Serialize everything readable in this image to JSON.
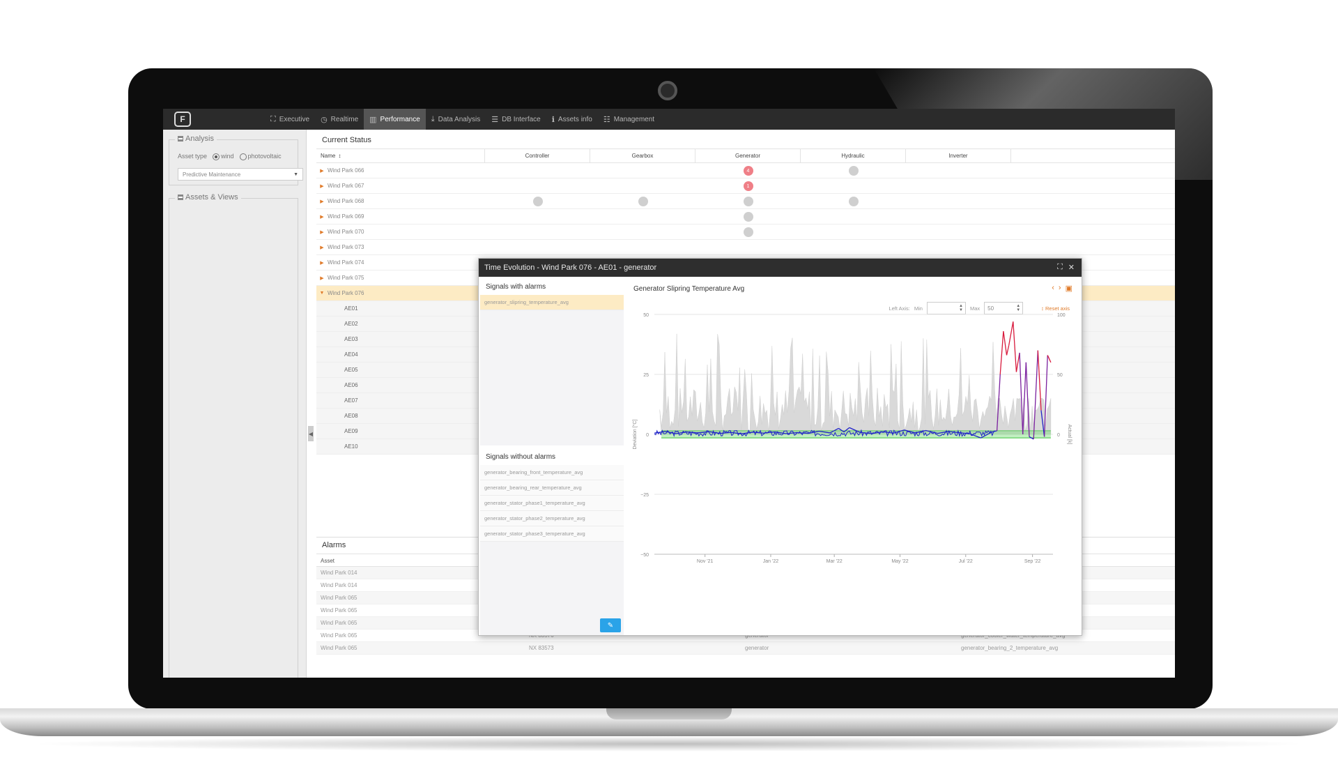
{
  "nav": {
    "logo": "F",
    "items": [
      {
        "label": "Executive",
        "icon": "chart-line-icon",
        "glyph": "⛶"
      },
      {
        "label": "Realtime",
        "icon": "clock-icon",
        "glyph": "◷"
      },
      {
        "label": "Performance",
        "icon": "bar-chart-icon",
        "glyph": "▥"
      },
      {
        "label": "Data Analysis",
        "icon": "download-icon",
        "glyph": "⤓"
      },
      {
        "label": "DB Interface",
        "icon": "database-icon",
        "glyph": "☰"
      },
      {
        "label": "Assets info",
        "icon": "info-icon",
        "glyph": "ℹ"
      },
      {
        "label": "Management",
        "icon": "list-icon",
        "glyph": "☷"
      }
    ]
  },
  "left": {
    "analysis_legend": "Analysis",
    "asset_type_label": "Asset type",
    "radio_wind": "wind",
    "radio_pv": "photovoltaic",
    "select_value": "Predictive Maintenance",
    "assets_legend": "Assets & Views"
  },
  "status": {
    "title": "Current Status",
    "columns": [
      "Name",
      "Controller",
      "Gearbox",
      "Generator",
      "Hydraulic",
      "Inverter"
    ],
    "rows": [
      "Wind Park 066",
      "Wind Park 067",
      "Wind Park 068",
      "Wind Park 069",
      "Wind Park 070",
      "Wind Park 073",
      "Wind Park 074",
      "Wind Park 075",
      "Wind Park 076"
    ],
    "children": [
      "AE01",
      "AE02",
      "AE03",
      "AE04",
      "AE05",
      "AE06",
      "AE07",
      "AE08",
      "AE09",
      "AE10"
    ],
    "badge_066": "4",
    "badge_067": "1"
  },
  "alarms": {
    "title": "Alarms",
    "header": "Asset",
    "rows": [
      [
        "Wind Park 014",
        "",
        "",
        ""
      ],
      [
        "Wind Park 014",
        "",
        "",
        ""
      ],
      [
        "Wind Park 065",
        "",
        "",
        ""
      ],
      [
        "Wind Park 065",
        "",
        "",
        ""
      ],
      [
        "Wind Park 065",
        "",
        "",
        ""
      ],
      [
        "Wind Park 065",
        "NX 83576",
        "generator",
        "generator_cooler_water_temperature_avg"
      ],
      [
        "Wind Park 065",
        "NX 83573",
        "generator",
        "generator_bearing_2_temperature_avg"
      ]
    ]
  },
  "modal": {
    "title": "Time Evolution - Wind Park 076 - AE01 - generator",
    "signals_with_alarms_title": "Signals with alarms",
    "signals_with_alarms": [
      "generator_slipring_temperature_avg"
    ],
    "signals_without_alarms_title": "Signals without alarms",
    "signals_without_alarms": [
      "generator_bearing_front_temperature_avg",
      "generator_bearing_rear_temperature_avg",
      "generator_stator_phase1_temperature_avg",
      "generator_stator_phase2_temperature_avg",
      "generator_stator_phase3_temperature_avg"
    ],
    "chart_title": "Generator Slipring Temperature Avg",
    "left_axis_label": "Left Axis:",
    "min_label": "Min",
    "max_label": "Max",
    "min_value": "",
    "max_value": "50",
    "reset_label": "Reset axis"
  },
  "chart_data": {
    "type": "line",
    "title": "Generator Slipring Temperature Avg",
    "ylabel": "Deviation [°C]",
    "y2label": "Actual [k]",
    "ylim": [
      -50,
      50
    ],
    "y2lim": [
      0,
      100
    ],
    "yticks": [
      50,
      25,
      0,
      -25,
      -50
    ],
    "y2ticks": [
      100,
      50,
      0
    ],
    "xtick_labels": [
      "Nov '21",
      "Jan '22",
      "Mar '22",
      "May '22",
      "Jul '22",
      "Sep '22"
    ],
    "xlim": [
      "2021-09-15",
      "2022-09-20"
    ],
    "xticks": [
      "2021-11-01",
      "2022-01-01",
      "2022-03-01",
      "2022-05-01",
      "2022-07-01",
      "2022-09-01"
    ],
    "normal_band": [
      -1.5,
      1.5
    ],
    "series": [
      {
        "kind": "deviation",
        "color_normal": "#1e22c8",
        "color_alarm": "#d81a3c",
        "points": [
          [
            "2021-09-15",
            0.5
          ],
          [
            "2021-09-25",
            1.2
          ],
          [
            "2021-10-05",
            0.3
          ],
          [
            "2021-10-15",
            1.0
          ],
          [
            "2021-10-25",
            0.6
          ],
          [
            "2021-11-05",
            1.1
          ],
          [
            "2021-11-15",
            0.4
          ],
          [
            "2021-11-25",
            0.8
          ],
          [
            "2021-12-05",
            0.2
          ],
          [
            "2021-12-15",
            0.9
          ],
          [
            "2021-12-25",
            0.5
          ],
          [
            "2022-01-05",
            1.0
          ],
          [
            "2022-01-15",
            0.3
          ],
          [
            "2022-01-25",
            0.7
          ],
          [
            "2022-02-05",
            0.4
          ],
          [
            "2022-02-15",
            1.3
          ],
          [
            "2022-02-25",
            0.6
          ],
          [
            "2022-03-05",
            2.5
          ],
          [
            "2022-03-10",
            1.0
          ],
          [
            "2022-03-15",
            2.8
          ],
          [
            "2022-03-25",
            0.8
          ],
          [
            "2022-04-05",
            0.3
          ],
          [
            "2022-04-15",
            1.1
          ],
          [
            "2022-04-25",
            0.5
          ],
          [
            "2022-05-05",
            1.8
          ],
          [
            "2022-05-15",
            0.6
          ],
          [
            "2022-05-25",
            1.6
          ],
          [
            "2022-06-05",
            0.4
          ],
          [
            "2022-06-15",
            1.2
          ],
          [
            "2022-06-25",
            0.7
          ],
          [
            "2022-07-05",
            0.2
          ],
          [
            "2022-07-15",
            -1.5
          ],
          [
            "2022-07-25",
            0.9
          ],
          [
            "2022-07-30",
            1.5
          ],
          [
            "2022-08-02",
            25
          ],
          [
            "2022-08-05",
            43
          ],
          [
            "2022-08-08",
            33
          ],
          [
            "2022-08-10",
            37
          ],
          [
            "2022-08-14",
            47
          ],
          [
            "2022-08-17",
            26
          ],
          [
            "2022-08-20",
            34
          ],
          [
            "2022-08-23",
            0
          ],
          [
            "2022-08-26",
            30
          ],
          [
            "2022-08-29",
            -1
          ],
          [
            "2022-09-02",
            -2
          ],
          [
            "2022-09-06",
            35
          ],
          [
            "2022-09-09",
            10
          ],
          [
            "2022-09-12",
            -1
          ],
          [
            "2022-09-15",
            33
          ],
          [
            "2022-09-18",
            30
          ]
        ]
      }
    ]
  },
  "colors": {
    "accent": "#e07b2a",
    "alarm_badge": "#ef7f87",
    "selected_row": "#fdebc4",
    "edit_button": "#2aa3e8"
  }
}
